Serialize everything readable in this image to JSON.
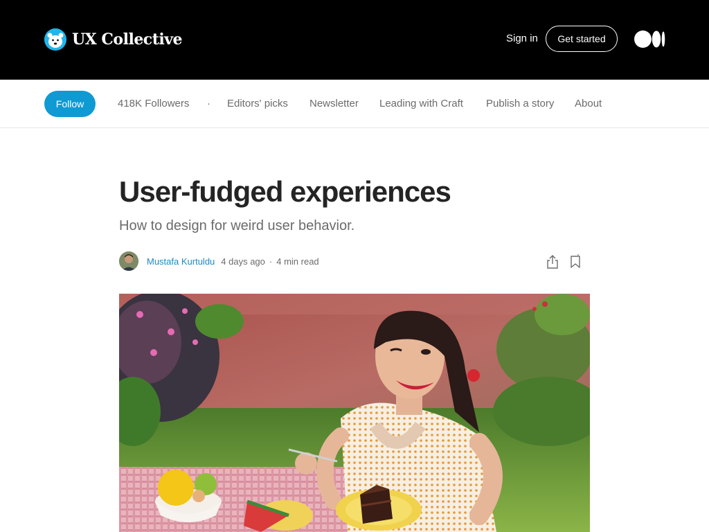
{
  "header": {
    "brand_name": "UX Collective",
    "brand_logo_icon": "polar-bear-logo-icon",
    "sign_in_label": "Sign in",
    "get_started_label": "Get started",
    "medium_logo_icon": "medium-logo-icon"
  },
  "publication_nav": {
    "follow_label": "Follow",
    "followers": "418K Followers",
    "separator": "·",
    "links": [
      "Editors' picks",
      "Newsletter",
      "Leading with Craft",
      "Publish a story",
      "About"
    ]
  },
  "article": {
    "title": "User-fudged experiences",
    "subtitle": "How to design for weird user behavior.",
    "author": "Mustafa Kurtuldu",
    "published": "4 days ago",
    "separator": "·",
    "read_time": "4 min read",
    "share_icon": "share-icon",
    "bookmark_icon": "bookmark-icon",
    "hero_image": "woman-eating-chocolate-cake-picnic-photo"
  },
  "colors": {
    "header_bg": "#000000",
    "follow_accent": "#0f9ad3",
    "author_link": "#1e89c5",
    "title_text": "#242424",
    "muted_text": "#6b6b6b"
  }
}
